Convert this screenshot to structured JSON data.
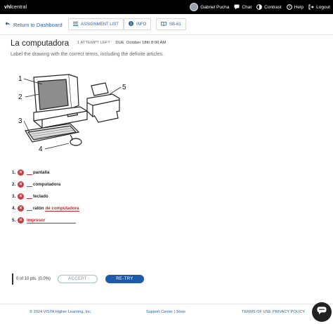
{
  "topbar": {
    "brand_bold": "vhl",
    "brand_rest": "central",
    "user": "Gabriel Pucha",
    "chat": "Chat",
    "contrast": "Contrast",
    "help": "Help",
    "logout": "Logout"
  },
  "subnav": {
    "return": "Return to Dashboard",
    "assignment_list": "ASSIGNMENT LIST",
    "info": "INFO",
    "page_ref": "SB-61"
  },
  "activity": {
    "title": "La computadora",
    "attempts": "1 ATTEMPT LEFT",
    "due_label": "DUE",
    "due_date": "October 18th 8:00 AM",
    "instructions": "Label the drawing with the correct terms, including the definite articles."
  },
  "drawing_labels": [
    "1",
    "2",
    "3",
    "4",
    "5"
  ],
  "answers": [
    {
      "num": "1.",
      "text": "pantalla",
      "response": ""
    },
    {
      "num": "2.",
      "text": "computadora",
      "response": ""
    },
    {
      "num": "3.",
      "text": "teclado",
      "response": ""
    },
    {
      "num": "4.",
      "text": "ratón",
      "response": "de computadora"
    },
    {
      "num": "5.",
      "text": "",
      "response": "impresor"
    }
  ],
  "score": {
    "text": "0 of 10 pts. (0.0%)",
    "accept": "ACCEPT",
    "retry": "RE-TRY"
  },
  "footer": {
    "copyright": "© 2024 VISTA Higher Learning, Inc.",
    "support": "Support Center | Store",
    "terms": "TERMS OF USE",
    "privacy": "PRIVACY POLICY"
  },
  "colors": {
    "topbar_bg": "#000000",
    "link": "#2b5fa6",
    "error": "#d0393e",
    "primary_button": "#1e5aa8"
  }
}
